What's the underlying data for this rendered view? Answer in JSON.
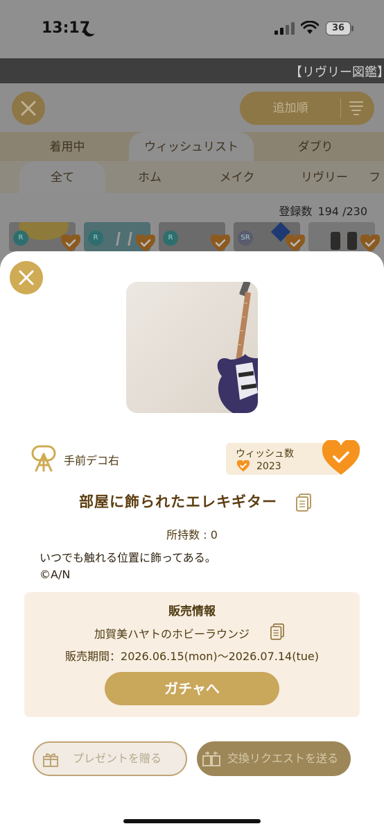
{
  "status_bar": {
    "time": "13:17",
    "battery": "36"
  },
  "background_app": {
    "title": "【リヴリー図鑑】",
    "sort_label": "追加順",
    "tabs": [
      {
        "label": "着用中"
      },
      {
        "label": "ウィッシュリスト"
      },
      {
        "label": "ダブり"
      }
    ],
    "subtabs": [
      {
        "label": "全て"
      },
      {
        "label": "ホム"
      },
      {
        "label": "メイク"
      },
      {
        "label": "リヴリー"
      },
      {
        "label": "フ"
      }
    ],
    "registered_label": "登録数",
    "registered_count": "194 /230",
    "thumb_badges": [
      "R",
      "R",
      "R",
      "SR"
    ]
  },
  "item": {
    "slot_label": "手前デコ右",
    "wish_title": "ウィッシュ数",
    "wish_count": "2023",
    "name": "部屋に飾られたエレキギター",
    "owned": "所持数 : 0",
    "description": "いつでも触れる位置に飾ってある。",
    "copyright": "©A/N"
  },
  "sales": {
    "title": "販売情報",
    "shop": "加賀美ハヤトのホビーラウンジ",
    "period": "販売期間：2026.06.15(mon)〜2026.07.14(tue)",
    "gacha_button": "ガチャへ"
  },
  "actions": {
    "present_button": "プレゼントを贈る",
    "exchange_button": "交換リクエストを送る"
  },
  "colors": {
    "accent_gold": "#cfab55",
    "heart_orange": "#f5931e",
    "text_brown": "#5c3d10"
  }
}
